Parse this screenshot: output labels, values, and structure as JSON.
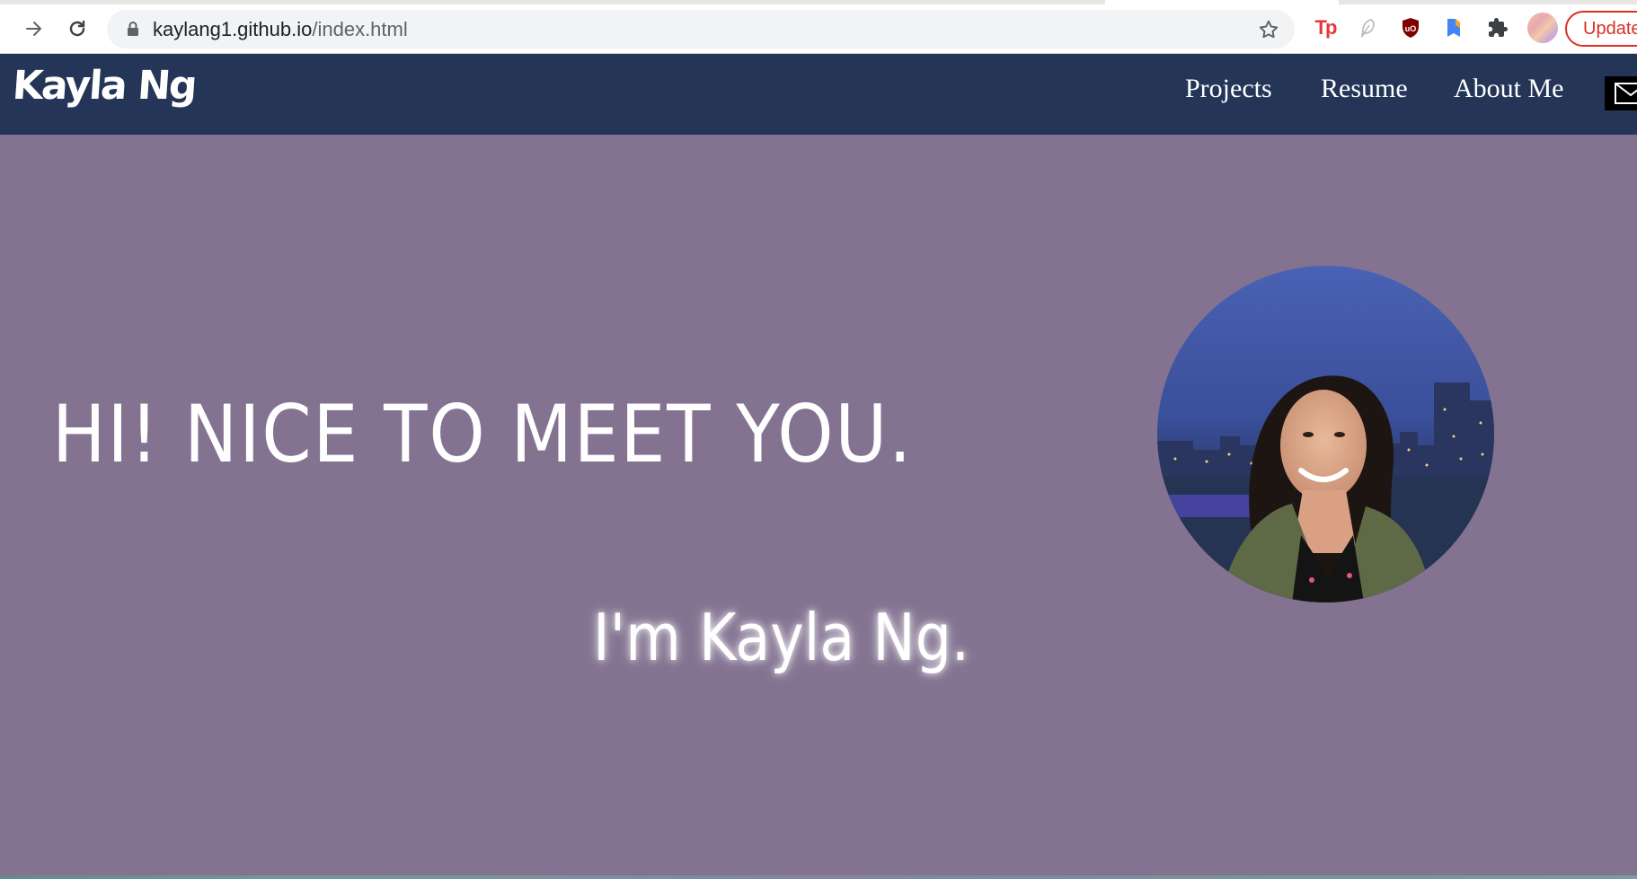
{
  "browser": {
    "url_host": "kaylang1.github.io",
    "url_path": "/index.html",
    "update_label": "Update",
    "extensions": {
      "tp_label": "Tp"
    },
    "icons": [
      "forward-icon",
      "reload-icon",
      "lock-icon",
      "star-icon",
      "feather-icon",
      "ublock-icon",
      "bookmark-icon",
      "puzzle-icon"
    ]
  },
  "site": {
    "brand": "Kayla Ng",
    "nav": {
      "projects": "Projects",
      "resume": "Resume",
      "about": "About Me"
    },
    "colors": {
      "navbar": "#243558",
      "background": "#837391",
      "text": "#ffffff"
    }
  },
  "hero": {
    "headline": "HI! NICE TO MEET YOU.",
    "subline": "I'm Kayla Ng."
  }
}
